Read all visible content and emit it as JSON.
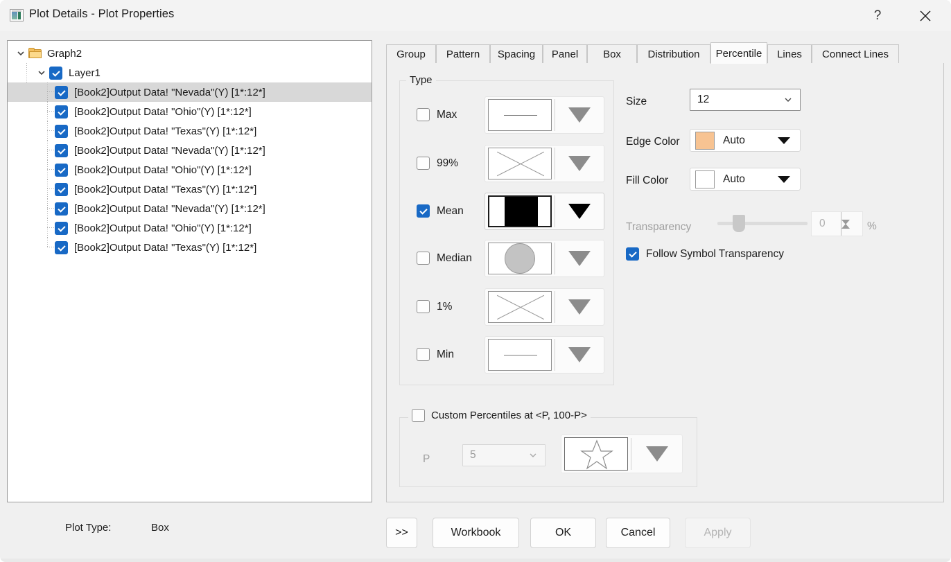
{
  "window": {
    "title": "Plot Details - Plot Properties",
    "help_label": "?",
    "close_label": "✕"
  },
  "tree": {
    "root": {
      "label": "Graph2",
      "icon": "folder-icon",
      "expanded": true
    },
    "layer": {
      "label": "Layer1",
      "checked": true,
      "expanded": true
    },
    "plots": [
      {
        "label": "[Book2]Output Data! \"Nevada\"(Y) [1*:12*]",
        "checked": true,
        "selected": true
      },
      {
        "label": "[Book2]Output Data! \"Ohio\"(Y) [1*:12*]",
        "checked": true,
        "selected": false
      },
      {
        "label": "[Book2]Output Data! \"Texas\"(Y) [1*:12*]",
        "checked": true,
        "selected": false
      },
      {
        "label": "[Book2]Output Data! \"Nevada\"(Y) [1*:12*]",
        "checked": true,
        "selected": false
      },
      {
        "label": "[Book2]Output Data! \"Ohio\"(Y) [1*:12*]",
        "checked": true,
        "selected": false
      },
      {
        "label": "[Book2]Output Data! \"Texas\"(Y) [1*:12*]",
        "checked": true,
        "selected": false
      },
      {
        "label": "[Book2]Output Data! \"Nevada\"(Y) [1*:12*]",
        "checked": true,
        "selected": false
      },
      {
        "label": "[Book2]Output Data! \"Ohio\"(Y) [1*:12*]",
        "checked": true,
        "selected": false
      },
      {
        "label": "[Book2]Output Data! \"Texas\"(Y) [1*:12*]",
        "checked": true,
        "selected": false
      }
    ]
  },
  "plot_type": {
    "label": "Plot Type:",
    "value": "Box"
  },
  "tabs": [
    {
      "label": "Group",
      "active": false
    },
    {
      "label": "Pattern",
      "active": false
    },
    {
      "label": "Spacing",
      "active": false
    },
    {
      "label": "Panel",
      "active": false
    },
    {
      "label": "Box",
      "active": false
    },
    {
      "label": "Distribution",
      "active": false
    },
    {
      "label": "Percentile",
      "active": true
    },
    {
      "label": "Lines",
      "active": false
    },
    {
      "label": "Connect Lines",
      "active": false
    }
  ],
  "type_group": {
    "title": "Type",
    "rows": [
      {
        "label": "Max",
        "checked": false,
        "symbol": "horizontal-line"
      },
      {
        "label": "99%",
        "checked": false,
        "symbol": "cross-x"
      },
      {
        "label": "Mean",
        "checked": true,
        "symbol": "filled-square"
      },
      {
        "label": "Median",
        "checked": false,
        "symbol": "filled-circle"
      },
      {
        "label": "1%",
        "checked": false,
        "symbol": "cross-x"
      },
      {
        "label": "Min",
        "checked": false,
        "symbol": "horizontal-line"
      }
    ]
  },
  "properties": {
    "size": {
      "label": "Size",
      "value": "12"
    },
    "edge_color": {
      "label": "Edge Color",
      "value": "Auto",
      "swatch": "#F7C392"
    },
    "fill_color": {
      "label": "Fill Color",
      "value": "Auto",
      "swatch": "#FFFFFF"
    },
    "transparency": {
      "label": "Transparency",
      "value": "0",
      "unit": "%",
      "enabled": false,
      "slider_percent": 0
    },
    "follow_symbol_transparency": {
      "label": "Follow Symbol Transparency",
      "checked": true
    }
  },
  "custom_percentiles": {
    "title": "Custom Percentiles at <P, 100-P>",
    "checked": false,
    "p_label": "P",
    "p_value": "5",
    "symbol": "star"
  },
  "buttons": {
    "expand": ">>",
    "workbook": "Workbook",
    "ok": "OK",
    "cancel": "Cancel",
    "apply": "Apply",
    "apply_enabled": false
  },
  "colors": {
    "accent": "#1869C5",
    "dialog_bg": "#F0F0F0",
    "selection": "#D8D8D8"
  }
}
